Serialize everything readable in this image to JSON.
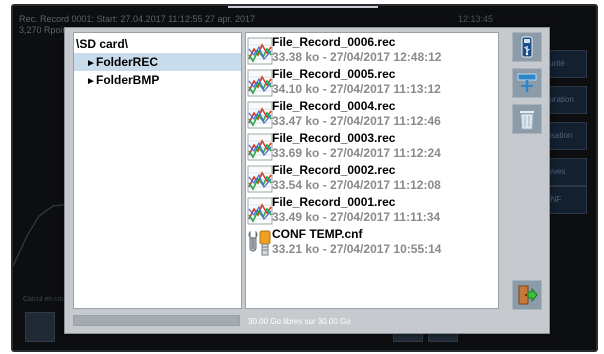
{
  "background": {
    "status_line1": "Rec. Record 0001: Start: 27.04.2017 11:12:55   27 apr. 2017",
    "status_line2": "3,270 Rpoint",
    "time": "12:13:45",
    "bottom_label": "Calcul en cours",
    "menu_items": [
      "Sécurité",
      "Configuration",
      "Visualisation",
      "Archives",
      "CONF"
    ]
  },
  "explorer": {
    "root": "\\SD card\\",
    "folders": [
      {
        "label": "FolderREC",
        "selected": true
      },
      {
        "label": "FolderBMP",
        "selected": false
      }
    ],
    "files": [
      {
        "name": "File_Record_0006.rec",
        "meta": "33.38 ko - 27/04/2017 12:48:12",
        "icon": "record-file-icon"
      },
      {
        "name": "File_Record_0005.rec",
        "meta": "34.10 ko - 27/04/2017 11:13:12",
        "icon": "record-file-icon"
      },
      {
        "name": "File_Record_0004.rec",
        "meta": "33.47 ko - 27/04/2017 11:12:46",
        "icon": "record-file-icon"
      },
      {
        "name": "File_Record_0003.rec",
        "meta": "33.69 ko - 27/04/2017 11:12:24",
        "icon": "record-file-icon"
      },
      {
        "name": "File_Record_0002.rec",
        "meta": "33.54 ko - 27/04/2017 11:12:08",
        "icon": "record-file-icon"
      },
      {
        "name": "File_Record_0001.rec",
        "meta": "33.49 ko - 27/04/2017 11:11:34",
        "icon": "record-file-icon"
      },
      {
        "name": "CONF TEMP.cnf",
        "meta": "33.21 ko - 27/04/2017 10:55:14",
        "icon": "config-file-icon"
      }
    ],
    "free_space": "30.00 Go libres sur 30.00 Go",
    "storage_used_fraction": 0.0,
    "buttons": [
      "usb-icon",
      "network-icon",
      "trash-icon",
      "exit-icon"
    ]
  },
  "colors": {
    "selection": "#c8dcec",
    "dialog_bg": "#c6c9cd",
    "side_button": "#8c9ba8"
  }
}
